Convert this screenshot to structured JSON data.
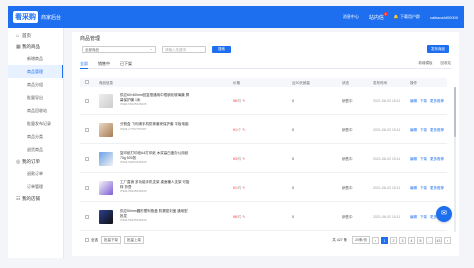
{
  "header": {
    "logo": "看采购",
    "brand": "商家后台",
    "nav": [
      "消息中心",
      "站内信",
      "下载用户群",
      "caibaoshi00000"
    ],
    "badge": "1"
  },
  "sidebar": {
    "top": [
      {
        "icon": "⌂",
        "label": "首页"
      },
      {
        "icon": "▦",
        "label": "我的商品"
      }
    ],
    "sub1": [
      "新增商品",
      "商品管理",
      "商品分组",
      "批量导出",
      "商品回收站",
      "批量发布记录",
      "商品分类",
      "退货商品"
    ],
    "group2": {
      "icon": "◎",
      "label": "我的订单"
    },
    "sub2": [
      "退款订单",
      "订单管理"
    ],
    "group3": {
      "icon": "☷",
      "label": "我的店铺"
    }
  },
  "main": {
    "title": "商品管理",
    "select": "全部商品",
    "search_placeholder": "请输入关键词",
    "search_btn": "搜索",
    "publish": "发布商品",
    "tabs": [
      "全部",
      "销售中",
      "已下架"
    ],
    "tools": [
      "新增模板",
      "回收站"
    ],
    "headers": [
      "商品信息",
      "价格",
      "近30天销量",
      "状态",
      "发布时间",
      "操作"
    ],
    "rows": [
      {
        "name": "供应60×60mm回复框通用中框钢化玻璃膜 屏幕保护膜 1米",
        "code": "ITEM-56345345235",
        "price": "¥8",
        "unit": "/件",
        "sales": "0",
        "status": "销售中",
        "date": "2021-06-02 15:11",
        "ops": [
          "编辑",
          "下架",
          "更多推荐"
        ]
      },
      {
        "name": "分割盒 飞利浦手机防摔套壳保护套 平板电脑",
        "code": "ITEM-17757756787",
        "price": "¥1",
        "unit": "/个",
        "sales": "0",
        "status": "销售中",
        "date": "2021-06-02 15:11",
        "ops": [
          "编辑",
          "下架",
          "更多推荐"
        ]
      },
      {
        "name": "复印纸打印纸A4打印纸 木浆高白度办公用纸 70g 500张",
        "code": "ITEM-53454345345",
        "price": "¥3",
        "unit": "/件",
        "sales": "0",
        "status": "销售中",
        "date": "2021-06-02 15:11",
        "ops": [
          "编辑",
          "下架",
          "更多推荐"
        ]
      },
      {
        "name": "工厂直销 多功能手机支架 桌面懒人支架 可旋转 折叠",
        "code": "ITEM-56345345235",
        "price": "¥1",
        "unit": "/件",
        "sales": "0",
        "status": "销售中",
        "date": "2021-06-02 15:11",
        "ops": [
          "编辑",
          "下架",
          "更多推荐"
        ]
      },
      {
        "name": "供应50mm圆形塑料瓶盖 防漏密封盖 通用型 批发",
        "code": "ITEM-56345345235",
        "price": "¥8",
        "unit": "/件",
        "sales": "0",
        "status": "销售中",
        "date": "2021-06-02 15:11",
        "ops": [
          "编辑",
          "下架",
          "更多推荐"
        ]
      }
    ],
    "footer": {
      "checkall": "全选",
      "btn1": "批量下架",
      "btn2": "批量上架",
      "total": "共 427 条",
      "per_page": "20条/页",
      "pages": [
        "‹",
        "1",
        "2",
        "3",
        "4",
        "5",
        "…",
        "43",
        "›"
      ]
    }
  },
  "colors": {
    "accent": "#1e6ff0"
  }
}
